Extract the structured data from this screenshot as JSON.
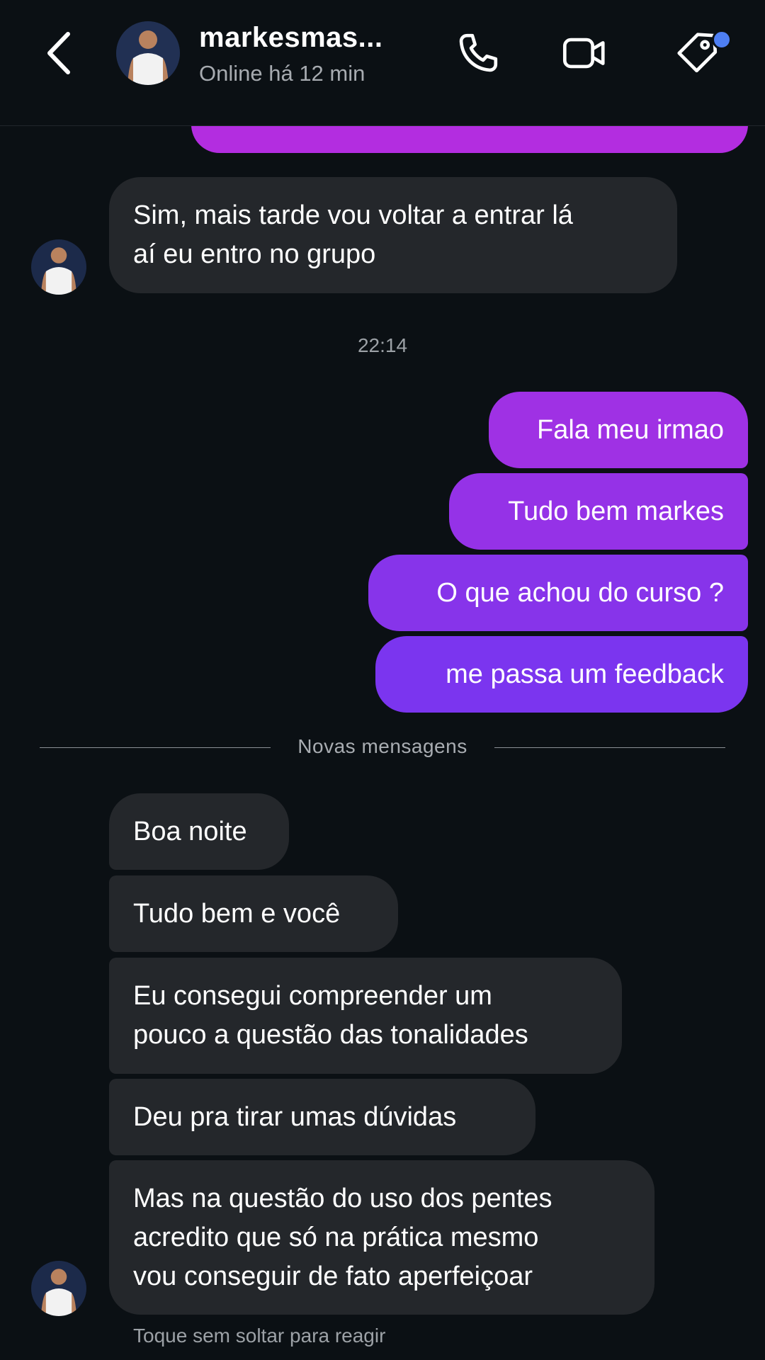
{
  "header": {
    "username": "markesmas...",
    "status": "Online há 12 min",
    "icons": [
      "chevron-left-icon",
      "phone-icon",
      "video-camera-icon",
      "tag-icon"
    ],
    "notification_dot_color": "#4e7ff3"
  },
  "colors": {
    "background": "#0b1014",
    "incoming_bubble": "#24272b",
    "outgoing_gradient_top": "#b32de0",
    "outgoing_gradient_bottom": "#7b35ef"
  },
  "messages": {
    "m1": "Sim, mais tarde vou voltar a entrar lá\naí eu entro no grupo",
    "timestamp": "22:14",
    "o1": "Fala meu irmao",
    "o2": "Tudo bem markes",
    "o3": "O que achou do curso ?",
    "o4": "me passa um feedback",
    "divider_label": "Novas mensagens",
    "i1": "Boa noite",
    "i2": "Tudo bem e você",
    "i3": "Eu consegui compreender um\npouco a questão das tonalidades",
    "i4": "Deu pra tirar umas dúvidas",
    "i5": "Mas na questão do uso dos pentes\nacredito que só na prática mesmo\nvou conseguir de fato aperfeiçoar",
    "hint": "Toque sem soltar para reagir"
  }
}
